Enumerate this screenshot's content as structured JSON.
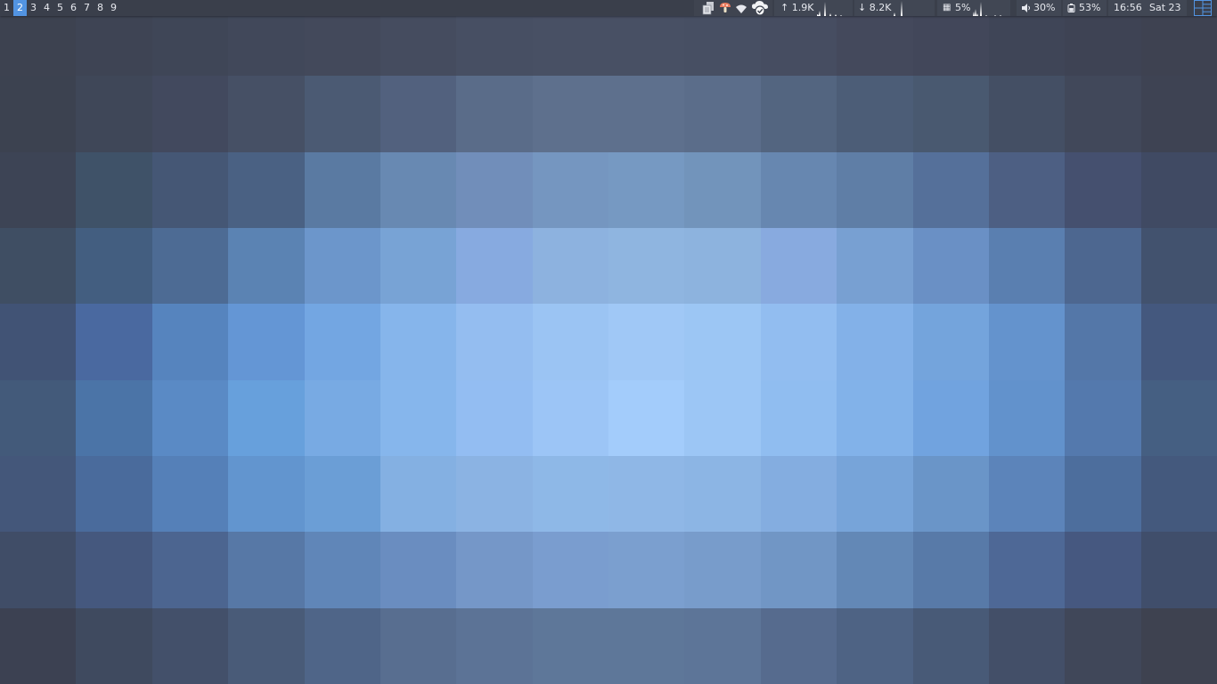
{
  "panel": {
    "workspaces": [
      "1",
      "2",
      "3",
      "4",
      "5",
      "6",
      "7",
      "8",
      "9"
    ],
    "active_workspace": "2",
    "tray": {
      "icons": [
        "clipboard-icon",
        "mushroom-icon",
        "wifi-icon",
        "cloud-sync-icon"
      ]
    },
    "net_up": "↑ 1.9K",
    "net_down": "↓ 8.2K",
    "cpu": "5%",
    "volume": "30%",
    "battery": "53%",
    "time": "16:56",
    "date": "Sat 23",
    "layout_icon": "grid-layout-icon"
  },
  "colors": {
    "panel_bg": "#3a3f4b",
    "segment_bg": "#414754",
    "accent": "#5294e2",
    "text": "#e6e8ee"
  },
  "wallpaper": {
    "style": "blurred pixel mosaic",
    "tiles": [
      [
        "#3d4250",
        "#3e4454",
        "#3f4657",
        "#41485a",
        "#43495b",
        "#454c5f",
        "#474f63",
        "#485064",
        "#485064",
        "#474f63",
        "#464d61",
        "#44495c",
        "#42475a",
        "#3f4557",
        "#3e4354",
        "#3e4251"
      ],
      [
        "#3c4250",
        "#3f4758",
        "#42495e",
        "#465065",
        "#4b5a73",
        "#52617e",
        "#5a6c89",
        "#5e708d",
        "#5e708d",
        "#5b6d8a",
        "#536580",
        "#4c5d77",
        "#495970",
        "#444f64",
        "#41485a",
        "#3e4353"
      ],
      [
        "#3d4455",
        "#3f5268",
        "#455775",
        "#4a6183",
        "#5a7aa2",
        "#6889b2",
        "#718eba",
        "#7596c0",
        "#7699c2",
        "#7294bb",
        "#6787b0",
        "#5f7ea6",
        "#55709a",
        "#4d5f83",
        "#45506f",
        "#404a63"
      ],
      [
        "#3f4e63",
        "#435e80",
        "#4d6b94",
        "#5b83b3",
        "#6c96cb",
        "#78a3d5",
        "#87aae0",
        "#8db2df",
        "#8fb5e0",
        "#8db3de",
        "#88aadf",
        "#78a0d2",
        "#6a90c5",
        "#5a7fb0",
        "#4d6790",
        "#42526e"
      ],
      [
        "#415375",
        "#4a69a0",
        "#5684be",
        "#6496d5",
        "#73a6e2",
        "#86b5eb",
        "#94bdf0",
        "#9bc4f3",
        "#a0c8f6",
        "#9cc6f4",
        "#92bdf0",
        "#83b1e8",
        "#74a4dc",
        "#6493cd",
        "#5477a8",
        "#44587e"
      ],
      [
        "#435a7a",
        "#4b74a7",
        "#5a8ac5",
        "#67a0dc",
        "#78aae3",
        "#86b6ec",
        "#93bdf2",
        "#9cc5f6",
        "#a3ccfb",
        "#9cc6f5",
        "#90bdf0",
        "#82b2e9",
        "#71a3df",
        "#6292cc",
        "#5479ad",
        "#455f82"
      ],
      [
        "#44577a",
        "#4a6b9c",
        "#5580b8",
        "#6295cf",
        "#6b9ed6",
        "#84b0e2",
        "#8bb3e3",
        "#8eb8e7",
        "#8fb7e6",
        "#8cb5e4",
        "#84ade0",
        "#77a4d9",
        "#6a95c8",
        "#5c84ba",
        "#4d6e9d",
        "#44597d"
      ],
      [
        "#404d67",
        "#45587e",
        "#4c6590",
        "#5778a6",
        "#6086b8",
        "#6a8dc0",
        "#7597c8",
        "#7a9dcf",
        "#7b9fcf",
        "#789ccb",
        "#7196c5",
        "#6388b6",
        "#587aa8",
        "#4e6896",
        "#465880",
        "#404e6b"
      ],
      [
        "#3c4152",
        "#3f4a5f",
        "#43506a",
        "#495b78",
        "#4f6588",
        "#586e90",
        "#5c7396",
        "#5e7799",
        "#5e7799",
        "#5d7598",
        "#566b8e",
        "#4e6384",
        "#485a77",
        "#434f68",
        "#404759",
        "#3e4250"
      ]
    ]
  }
}
